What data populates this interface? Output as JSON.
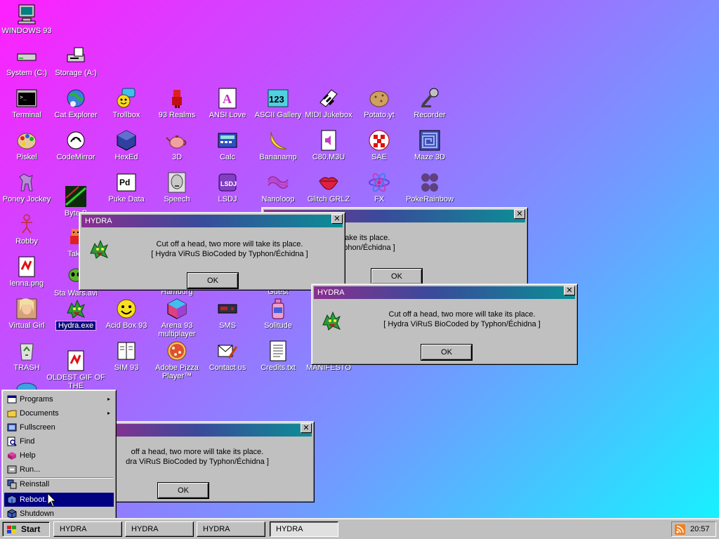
{
  "desktop": {
    "icons": {
      "windows93": {
        "label": "WINDOWS 93",
        "icon": "computer-icon"
      },
      "system_c": {
        "label": "System (C:)",
        "icon": "drive-icon"
      },
      "storage_a": {
        "label": "Storage (A:)",
        "icon": "floppy-drive-icon"
      },
      "terminal": {
        "label": "Terminal",
        "icon": "terminal-icon"
      },
      "cat_explorer": {
        "label": "Cat Explorer",
        "icon": "globe-cat-icon"
      },
      "trollbox": {
        "label": "Trollbox",
        "icon": "chat-smiley-icon"
      },
      "realms": {
        "label": "93 Realms",
        "icon": "knight-icon"
      },
      "ansi_love": {
        "label": "ANSI Love",
        "icon": "letter-a-icon"
      },
      "ascii_gallery": {
        "label": "ASCII Gallery",
        "icon": "numbers-123-icon"
      },
      "midi_jukebox": {
        "label": "MIDI Jukebox",
        "icon": "piano-keys-icon"
      },
      "potato": {
        "label": "Potato.yt",
        "icon": "potato-icon"
      },
      "recorder": {
        "label": "Recorder",
        "icon": "microphone-icon"
      },
      "piskel": {
        "label": "Piskel",
        "icon": "palette-icon"
      },
      "codemirror": {
        "label": "CodeMirror",
        "icon": "codemirror-icon"
      },
      "hexed": {
        "label": "HexEd",
        "icon": "cube-icon"
      },
      "three_d": {
        "label": "3D",
        "icon": "teapot-icon"
      },
      "calc": {
        "label": "Calc",
        "icon": "calculator-icon"
      },
      "bananamp": {
        "label": "Bananamp",
        "icon": "banana-icon"
      },
      "c80m3u": {
        "label": "C80.M3U",
        "icon": "audio-file-icon"
      },
      "sae": {
        "label": "SAE",
        "icon": "checkered-ball-icon"
      },
      "maze3d": {
        "label": "Maze 3D",
        "icon": "maze-icon"
      },
      "poney": {
        "label": "Poney Jockey",
        "icon": "pony-icon"
      },
      "byteb": {
        "label": "Byte B",
        "icon": "glitch-image-icon"
      },
      "puke": {
        "label": "Puke Data",
        "icon": "pd-icon"
      },
      "speech": {
        "label": "Speech",
        "icon": "face-speech-icon"
      },
      "lsdj": {
        "label": "LSDJ",
        "icon": "lsdj-icon"
      },
      "nanoloop": {
        "label": "Nanoloop",
        "icon": "waveform-icon"
      },
      "glitch_grlz": {
        "label": "Glitch GRLZ",
        "icon": "lips-icon"
      },
      "fx": {
        "label": "FX",
        "icon": "atom-icon"
      },
      "pokerainbow": {
        "label": "PokeRainbow",
        "icon": "pokemon-icon"
      },
      "robby": {
        "label": "Robby",
        "icon": "stick-figure-icon"
      },
      "take": {
        "label": "Take",
        "icon": "pixel-character-icon"
      },
      "lenna": {
        "label": "lenna.png",
        "icon": "broken-image-icon"
      },
      "starwars": {
        "label": "Sta Wars.avi",
        "icon": "alien-icon"
      },
      "hamburg": {
        "label": "Hamburg",
        "icon": "hamburger-icon"
      },
      "guest": {
        "label": "Guest",
        "icon": "guest-icon"
      },
      "virtual_girl": {
        "label": "Virtual Girl",
        "icon": "portrait-icon"
      },
      "hydra": {
        "label": "Hydra.exe",
        "icon": "dragon-icon"
      },
      "acid_box": {
        "label": "Acid Box 93",
        "icon": "acid-smiley-icon"
      },
      "arena": {
        "label": "Arena 93 multiplayer",
        "icon": "box-3d-icon"
      },
      "sms": {
        "label": "SMS",
        "icon": "console-icon"
      },
      "solitude": {
        "label": "Solitude",
        "icon": "bottle-icon"
      },
      "trash": {
        "label": "TRASH",
        "icon": "recycle-bin-icon"
      },
      "oldest_gif": {
        "label": "OLDEST GIF OF THE",
        "icon": "broken-image-icon"
      },
      "sim93": {
        "label": "SIM 93",
        "icon": "book-icon"
      },
      "adobe_pizza": {
        "label": "Adobe Pizza Player™",
        "icon": "pizza-icon"
      },
      "contact": {
        "label": "Contact us",
        "icon": "mail-pen-icon"
      },
      "credits": {
        "label": "Credits.txt",
        "icon": "text-file-icon"
      },
      "manifesto": {
        "label": "MANIFESTO",
        "icon": "document-icon"
      },
      "partial_bottom": {
        "label": "",
        "icon": "globe-icon"
      }
    }
  },
  "dialogs": [
    {
      "title": "HYDRA",
      "line1": "Cut off a head, two more will take its place.",
      "line2": "[ Hydra ViRuS BioCoded by Typhon/Échidna ]",
      "ok": "OK",
      "icon": "dragon-icon"
    },
    {
      "title": "",
      "line1": "Cut off a head, two more will take its place.",
      "line2": "[ Hydra ViRuS BioCoded by Typhon/Échidna ]",
      "ok": "OK",
      "icon": "dragon-icon"
    },
    {
      "title": "HYDRA",
      "line1": "Cut off a head, two more will take its place.",
      "line2": "[ Hydra ViRuS BioCoded by Typhon/Échidna ]",
      "ok": "OK",
      "icon": "dragon-icon"
    },
    {
      "title": "",
      "line1": "off a head, two more will take its place.",
      "line2": "dra ViRuS BioCoded by Typhon/Échidna ]",
      "ok": "OK",
      "icon": "dragon-icon"
    }
  ],
  "start_menu": {
    "items": [
      {
        "label": "Programs",
        "icon": "programs-icon",
        "submenu": true
      },
      {
        "label": "Documents",
        "icon": "folder-icon",
        "submenu": true
      },
      {
        "label": "Fullscreen",
        "icon": "fullscreen-icon"
      },
      {
        "label": "Find",
        "icon": "find-icon"
      },
      {
        "label": "Help",
        "icon": "help-icon"
      },
      {
        "label": "Run...",
        "icon": "run-icon"
      },
      {
        "label": "Reinstall",
        "icon": "reinstall-icon"
      },
      {
        "label": "Reboot...",
        "icon": "reboot-icon",
        "active": true
      },
      {
        "label": "Shutdown",
        "icon": "shutdown-icon"
      }
    ],
    "submenu_arrow": "▸"
  },
  "taskbar": {
    "start_label": "Start",
    "tasks": [
      "HYDRA",
      "HYDRA",
      "HYDRA",
      "HYDRA"
    ],
    "clock": "20:57",
    "tray_icon": "rss-icon"
  },
  "colors": {
    "window_bg": "#c0c0c0",
    "selection": "#000080",
    "title_start": "#8a2f8f",
    "title_end": "#0b8e96"
  }
}
